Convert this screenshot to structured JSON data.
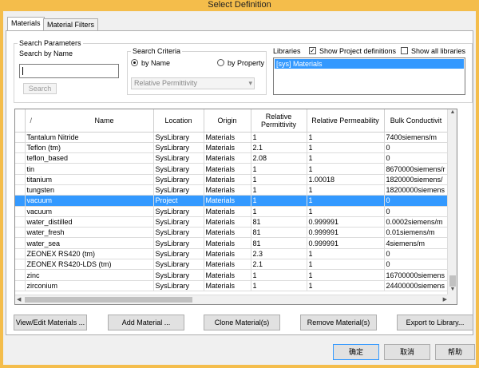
{
  "window": {
    "title": "Select Definition"
  },
  "tabs": [
    {
      "label": "Materials",
      "active": true
    },
    {
      "label": "Material Filters",
      "active": false
    }
  ],
  "search": {
    "group_label": "Search Parameters",
    "by_name_label": "Search by Name",
    "input_value": "",
    "search_button": "Search",
    "criteria_label": "Search Criteria",
    "criteria_options": [
      {
        "label": "by Name",
        "selected": true
      },
      {
        "label": "by Property",
        "selected": false
      }
    ],
    "property_select_value": "Relative Permittivity"
  },
  "libraries": {
    "label": "Libraries",
    "show_project_label": "Show Project definitions",
    "show_project_checked": true,
    "show_all_label": "Show all libraries",
    "show_all_checked": false,
    "items": [
      "[sys] Materials"
    ]
  },
  "table": {
    "columns": [
      {
        "key": "sort",
        "label": "/"
      },
      {
        "key": "name",
        "label": "Name"
      },
      {
        "key": "location",
        "label": "Location"
      },
      {
        "key": "origin",
        "label": "Origin"
      },
      {
        "key": "permittivity",
        "label": "Relative Permittivity"
      },
      {
        "key": "permeability",
        "label": "Relative Permeability"
      },
      {
        "key": "conductivity",
        "label": "Bulk Conductivit"
      }
    ],
    "rows": [
      {
        "name": "Tantalum Nitride",
        "location": "SysLibrary",
        "origin": "Materials",
        "permittivity": "1",
        "permeability": "1",
        "conductivity": "7400siemens/m"
      },
      {
        "name": "Teflon (tm)",
        "location": "SysLibrary",
        "origin": "Materials",
        "permittivity": "2.1",
        "permeability": "1",
        "conductivity": "0"
      },
      {
        "name": "teflon_based",
        "location": "SysLibrary",
        "origin": "Materials",
        "permittivity": "2.08",
        "permeability": "1",
        "conductivity": "0"
      },
      {
        "name": "tin",
        "location": "SysLibrary",
        "origin": "Materials",
        "permittivity": "1",
        "permeability": "1",
        "conductivity": "8670000siemens/r"
      },
      {
        "name": "titanium",
        "location": "SysLibrary",
        "origin": "Materials",
        "permittivity": "1",
        "permeability": "1.00018",
        "conductivity": "1820000siemens/"
      },
      {
        "name": "tungsten",
        "location": "SysLibrary",
        "origin": "Materials",
        "permittivity": "1",
        "permeability": "1",
        "conductivity": "18200000siemens"
      },
      {
        "name": "vacuum",
        "location": "Project",
        "origin": "Materials",
        "permittivity": "1",
        "permeability": "1",
        "conductivity": "0",
        "selected": true
      },
      {
        "name": "vacuum",
        "location": "SysLibrary",
        "origin": "Materials",
        "permittivity": "1",
        "permeability": "1",
        "conductivity": "0"
      },
      {
        "name": "water_distilled",
        "location": "SysLibrary",
        "origin": "Materials",
        "permittivity": "81",
        "permeability": "0.999991",
        "conductivity": "0.0002siemens/m"
      },
      {
        "name": "water_fresh",
        "location": "SysLibrary",
        "origin": "Materials",
        "permittivity": "81",
        "permeability": "0.999991",
        "conductivity": "0.01siemens/m"
      },
      {
        "name": "water_sea",
        "location": "SysLibrary",
        "origin": "Materials",
        "permittivity": "81",
        "permeability": "0.999991",
        "conductivity": "4siemens/m"
      },
      {
        "name": "ZEONEX RS420 (tm)",
        "location": "SysLibrary",
        "origin": "Materials",
        "permittivity": "2.3",
        "permeability": "1",
        "conductivity": "0"
      },
      {
        "name": "ZEONEX RS420-LDS (tm)",
        "location": "SysLibrary",
        "origin": "Materials",
        "permittivity": "2.1",
        "permeability": "1",
        "conductivity": "0"
      },
      {
        "name": "zinc",
        "location": "SysLibrary",
        "origin": "Materials",
        "permittivity": "1",
        "permeability": "1",
        "conductivity": "16700000siemens"
      },
      {
        "name": "zirconium",
        "location": "SysLibrary",
        "origin": "Materials",
        "permittivity": "1",
        "permeability": "1",
        "conductivity": "24400000siemens"
      }
    ]
  },
  "actions": {
    "view_edit": "View/Edit Materials ...",
    "add": "Add Material ...",
    "clone": "Clone Material(s)",
    "remove": "Remove Material(s)",
    "export": "Export to Library..."
  },
  "footer": {
    "ok": "确定",
    "cancel": "取消",
    "help": "帮助"
  },
  "colors": {
    "title_bar": "#f4bd4b",
    "selection": "#3399ff"
  }
}
